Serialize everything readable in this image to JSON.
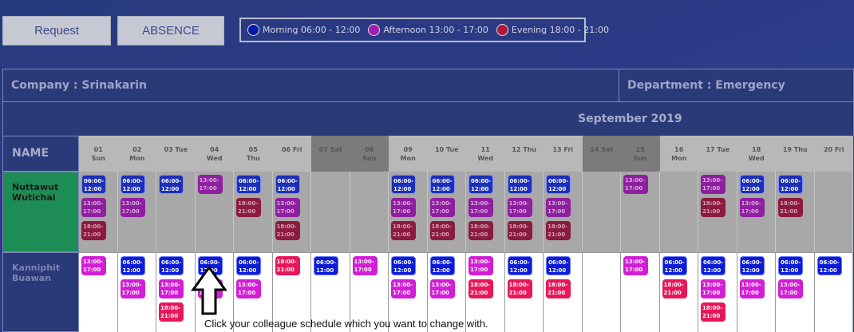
{
  "buttons": {
    "request": "Request",
    "absence": "ABSENCE"
  },
  "legend": [
    {
      "label": "Morning  06:00 -  12:00",
      "color": "#0a1aa8"
    },
    {
      "label": "Afternoon 13:00 -  17:00",
      "color": "#a31db4"
    },
    {
      "label": "Evening 18:00 -  21:00",
      "color": "#b0183f"
    }
  ],
  "company_label": "Company : Srinakarin",
  "department_label": "Department : Emergency",
  "month_label": "September 2019",
  "name_header": "NAME",
  "days": [
    {
      "num": "01",
      "dow": "Sun",
      "weekend": false
    },
    {
      "num": "02",
      "dow": "Mon",
      "weekend": false
    },
    {
      "num": "03",
      "dow": "Tue",
      "weekend": false
    },
    {
      "num": "04",
      "dow": "Wed",
      "weekend": false
    },
    {
      "num": "05",
      "dow": "Thu",
      "weekend": false
    },
    {
      "num": "06",
      "dow": "Fri",
      "weekend": false
    },
    {
      "num": "07",
      "dow": "Sat",
      "weekend": true
    },
    {
      "num": "08",
      "dow": "Sun",
      "weekend": true
    },
    {
      "num": "09",
      "dow": "Mon",
      "weekend": false
    },
    {
      "num": "10",
      "dow": "Tue",
      "weekend": false
    },
    {
      "num": "11",
      "dow": "Wed",
      "weekend": false
    },
    {
      "num": "12",
      "dow": "Thu",
      "weekend": false
    },
    {
      "num": "13",
      "dow": "Fri",
      "weekend": false
    },
    {
      "num": "14",
      "dow": "Sat",
      "weekend": true
    },
    {
      "num": "15",
      "dow": "Sun",
      "weekend": true
    },
    {
      "num": "16",
      "dow": "Mon",
      "weekend": false
    },
    {
      "num": "17",
      "dow": "Tue",
      "weekend": false
    },
    {
      "num": "18",
      "dow": "Wed",
      "weekend": false
    },
    {
      "num": "19",
      "dow": "Thu",
      "weekend": false
    },
    {
      "num": "20",
      "dow": "Fri",
      "weekend": false
    }
  ],
  "employees": [
    {
      "name": "Nuttawut Wutichai",
      "shifts": [
        [
          "m",
          "a",
          "e"
        ],
        [
          "m",
          "a"
        ],
        [
          "m"
        ],
        [
          "a"
        ],
        [
          "m",
          "e"
        ],
        [
          "m",
          "a",
          "e"
        ],
        [],
        [],
        [
          "m",
          "a",
          "e"
        ],
        [
          "m",
          "a",
          "e"
        ],
        [
          "m",
          "a",
          "e"
        ],
        [
          "m",
          "a",
          "e"
        ],
        [
          "m",
          "a",
          "e"
        ],
        [],
        [
          "a"
        ],
        [],
        [
          "a",
          "e"
        ],
        [
          "m",
          "a"
        ],
        [
          "m",
          "e"
        ],
        []
      ]
    },
    {
      "name": "Kanniphit Buawan",
      "shifts": [
        [
          "a"
        ],
        [
          "m",
          "a"
        ],
        [
          "m",
          "a",
          "e"
        ],
        [
          "m",
          "a"
        ],
        [
          "m",
          "a"
        ],
        [
          "e"
        ],
        [
          "m"
        ],
        [
          "a"
        ],
        [
          "m",
          "a"
        ],
        [
          "m",
          "a"
        ],
        [
          "a",
          "e"
        ],
        [
          "m",
          "e"
        ],
        [
          "m",
          "e"
        ],
        [],
        [
          "a"
        ],
        [
          "m",
          "e"
        ],
        [
          "m",
          "a",
          "e"
        ],
        [
          "m",
          "a"
        ],
        [
          "m",
          "a"
        ],
        [
          "m"
        ]
      ]
    }
  ],
  "shift_text": {
    "m": "06:00-\n12:00",
    "a": "13:00-\n17:00",
    "e": "18:00-\n21:00"
  },
  "hint": "Click your colleague schedule which you want to change with."
}
